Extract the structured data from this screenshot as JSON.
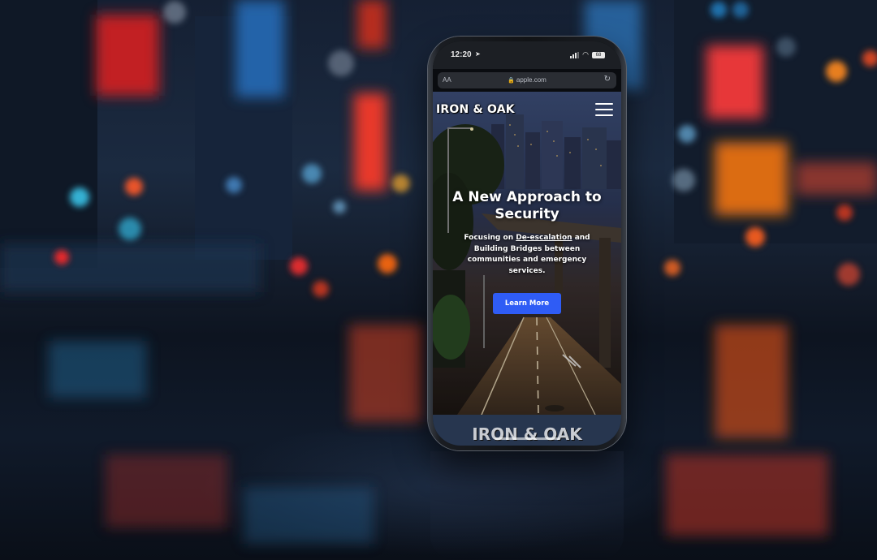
{
  "status_bar": {
    "time": "12:20",
    "battery": "68"
  },
  "url_bar": {
    "text_size_label": "AA",
    "url": "apple.com"
  },
  "site": {
    "logo": "IRON & OAK",
    "hero_title": "A New Approach to Security",
    "hero_subtitle_before": "Focusing on ",
    "hero_subtitle_link": "De-escalation",
    "hero_subtitle_after": " and Building Bridges between communities and emergency services.",
    "cta_label": "Learn More",
    "footer_logo": "IRON & OAK"
  },
  "icons": {
    "status": [
      "location-arrow-icon",
      "signal-icon",
      "wifi-icon",
      "battery-icon"
    ],
    "url_bar": [
      "lock-icon",
      "reload-icon"
    ],
    "site": [
      "hamburger-menu-icon"
    ]
  },
  "colors": {
    "cta_background": "#2f5cf5",
    "footer_band": "#27364f",
    "status_bar": "#1c1f24"
  }
}
